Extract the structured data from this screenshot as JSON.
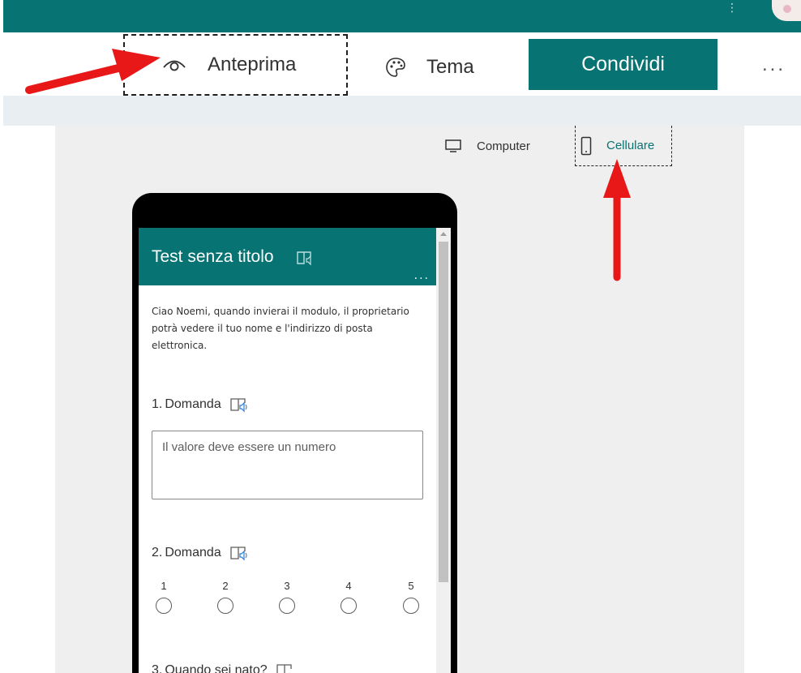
{
  "toolbar": {
    "preview_label": "Anteprima",
    "theme_label": "Tema",
    "share_label": "Condividi",
    "more_label": "...",
    "topbar_more": "⋮"
  },
  "view_switch": {
    "computer_label": "Computer",
    "mobile_label": "Cellulare",
    "selected": "Cellulare"
  },
  "form": {
    "title": "Test senza titolo",
    "more_label": "...",
    "intro": "Ciao Noemi, quando invierai il modulo, il proprietario potrà vedere il tuo nome e l'indirizzo di posta elettronica.",
    "questions": [
      {
        "number": "1.",
        "label": "Domanda",
        "placeholder": "Il valore deve essere un numero"
      },
      {
        "number": "2.",
        "label": "Domanda",
        "scale": [
          "1",
          "2",
          "3",
          "4",
          "5"
        ]
      },
      {
        "number": "3.",
        "label": "Quando sei nato?"
      }
    ]
  },
  "colors": {
    "brand": "#077372",
    "annotation_arrow": "#e81818",
    "stage_bg": "#efefef"
  },
  "icons": {
    "preview": "eye-icon",
    "theme": "palette-icon",
    "computer": "monitor-icon",
    "mobile": "phone-icon",
    "reader": "immersive-reader-icon"
  }
}
